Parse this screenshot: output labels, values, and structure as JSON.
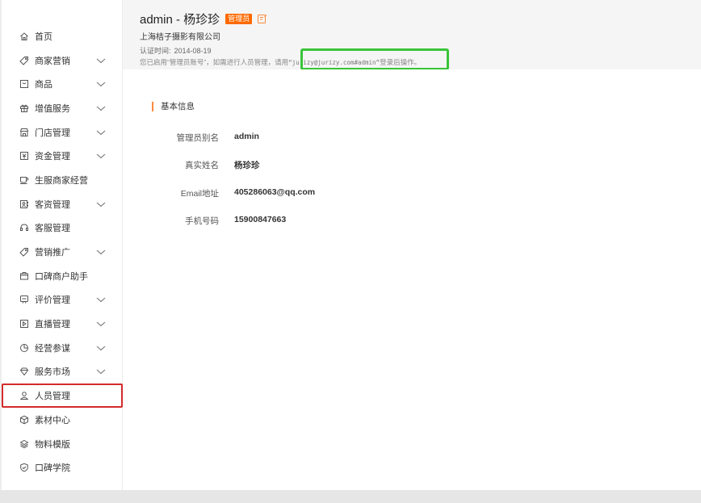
{
  "sidebar": {
    "items": [
      {
        "label": "首页",
        "icon": "home-icon",
        "expandable": false
      },
      {
        "label": "商家营销",
        "icon": "tag-icon",
        "expandable": true
      },
      {
        "label": "商品",
        "icon": "box-icon",
        "expandable": true
      },
      {
        "label": "增值服务",
        "icon": "gift-icon",
        "expandable": true
      },
      {
        "label": "门店管理",
        "icon": "store-icon",
        "expandable": true
      },
      {
        "label": "资金管理",
        "icon": "money-icon",
        "expandable": true
      },
      {
        "label": "生服商家经营",
        "icon": "cup-icon",
        "expandable": false
      },
      {
        "label": "客资管理",
        "icon": "contacts-icon",
        "expandable": true
      },
      {
        "label": "客服管理",
        "icon": "headset-icon",
        "expandable": false
      },
      {
        "label": "营销推广",
        "icon": "tag-icon",
        "expandable": true
      },
      {
        "label": "口碑商户助手",
        "icon": "wallet-icon",
        "expandable": false
      },
      {
        "label": "评价管理",
        "icon": "comment-icon",
        "expandable": true
      },
      {
        "label": "直播管理",
        "icon": "play-icon",
        "expandable": true
      },
      {
        "label": "经营参谋",
        "icon": "pie-chart-icon",
        "expandable": true
      },
      {
        "label": "服务市场",
        "icon": "diamond-icon",
        "expandable": true
      },
      {
        "label": "人员管理",
        "icon": "user-icon",
        "expandable": false
      },
      {
        "label": "素材中心",
        "icon": "cube-icon",
        "expandable": false
      },
      {
        "label": "物料模版",
        "icon": "layers-icon",
        "expandable": false
      },
      {
        "label": "口碑学院",
        "icon": "shield-icon",
        "expandable": false
      }
    ],
    "highlighted": "人员管理"
  },
  "header": {
    "title": "admin - 杨珍珍",
    "role_badge": "管理员",
    "company": "上海桔子摄影有限公司",
    "cert_label": "认证时间:",
    "cert_date": "2014-08-19",
    "note_prefix": "您已启用“管理员账号”，如需进行人员管理，请用",
    "note_account": "“jurizy@jurizy.com#admin”",
    "note_suffix": "登录后操作。"
  },
  "basic_info": {
    "section_title": "基本信息",
    "fields": [
      {
        "label": "管理员别名",
        "value": "admin"
      },
      {
        "label": "真实姓名",
        "value": "杨珍珍"
      },
      {
        "label": "Email地址",
        "value": "405286063@qq.com"
      },
      {
        "label": "手机号码",
        "value": "15900847663"
      }
    ]
  },
  "colors": {
    "accent": "#ff6a00",
    "highlight_red": "#d42a2a",
    "highlight_green": "#39c43a",
    "section_bar": "#ff8a3d"
  }
}
